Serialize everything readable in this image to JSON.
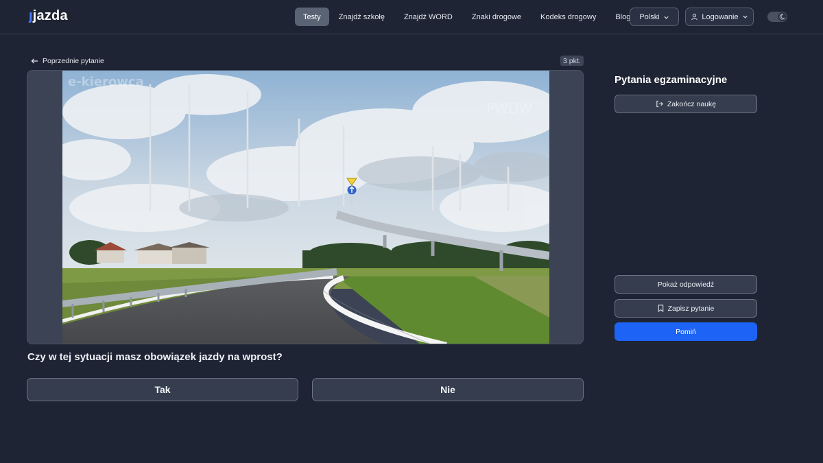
{
  "header": {
    "logo": "jazda",
    "nav": [
      {
        "label": "Testy",
        "active": true
      },
      {
        "label": "Znajdź szkołę",
        "active": false
      },
      {
        "label": "Znajdź WORD",
        "active": false
      },
      {
        "label": "Znaki drogowe",
        "active": false
      },
      {
        "label": "Kodeks drogowy",
        "active": false
      },
      {
        "label": "Blog",
        "active": false
      }
    ],
    "language": "Polski",
    "login": "Logowanie",
    "theme_toggle_icon": "moon-icon"
  },
  "question_area": {
    "prev_label": "Poprzednie pytanie",
    "points": "3 pkt.",
    "media_watermarks": [
      "e-kierowca",
      "PWDW"
    ],
    "question_text": "Czy w tej sytuacji masz obowiązek jazdy na wprost?",
    "answers": [
      "Tak",
      "Nie"
    ]
  },
  "side_panel": {
    "title": "Pytania egzaminacyjne",
    "end_label": "Zakończ naukę",
    "show_answer_label": "Pokaż odpowiedź",
    "save_label": "Zapisz pytanie",
    "skip_label": "Pomiń"
  },
  "colors": {
    "background": "#1e2433",
    "accent": "#1d63f5",
    "card": "#353d4e"
  }
}
